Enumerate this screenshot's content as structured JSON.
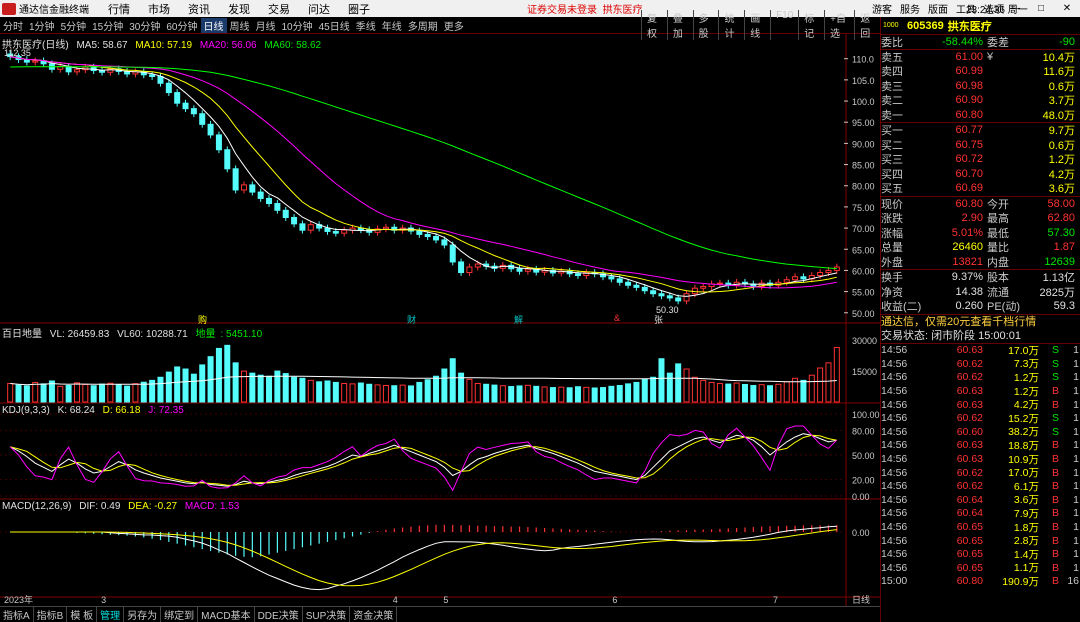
{
  "titlebar": {
    "app_name": "通达信金融终端",
    "menu": [
      "行情",
      "市场",
      "资讯",
      "发现",
      "交易",
      "问达",
      "圈子"
    ],
    "notice": "证券交易未登录",
    "stock": "拱东医疗",
    "right_menu": [
      "游客",
      "服务",
      "版面",
      "工具",
      "选项"
    ],
    "clock": "23:24:36 周一",
    "win": [
      "—",
      "□",
      "✕"
    ]
  },
  "periodbar": {
    "periods": [
      "分时",
      "1分钟",
      "5分钟",
      "15分钟",
      "30分钟",
      "60分钟",
      "日线",
      "周线",
      "月线",
      "10分钟",
      "45日线",
      "季线",
      "年线",
      "多周期",
      "更多"
    ],
    "active": "日线",
    "tools": [
      "复权",
      "叠加",
      "多股",
      "统计",
      "画线",
      "F10",
      "标记",
      "+自选",
      "返回"
    ]
  },
  "main_panel": {
    "title": "拱东医疗(日线)",
    "ma5": "MA5: 58.67",
    "ma10": "MA10: 57.19",
    "ma20": "MA20: 56.06",
    "ma60": "MA60: 58.62",
    "high_label": "112.35",
    "low_label": "50.30",
    "event_marks": [
      "购",
      "财",
      "解",
      "&",
      "张"
    ],
    "y_ticks": [
      "110.0",
      "105.0",
      "100.0",
      "95.00",
      "90.00",
      "85.00",
      "80.00",
      "75.00",
      "70.00",
      "65.00",
      "60.00",
      "55.00",
      "50.00"
    ]
  },
  "volume_panel": {
    "title": "百日地量",
    "vl": "VL: 26459.83",
    "vl60": "VL60: 10288.71",
    "label": "地量",
    "label_value": "5451.10",
    "y_ticks": [
      "30000",
      "15000"
    ]
  },
  "kdj_panel": {
    "title": "KDJ(9,3,3)",
    "k": "K: 68.24",
    "d": "D: 66.18",
    "j": "J: 72.35",
    "y_ticks": [
      "100.00",
      "80.00",
      "50.00",
      "20.00",
      "0.00"
    ]
  },
  "macd_panel": {
    "title": "MACD(12,26,9)",
    "dif": "DIF: 0.49",
    "dea": "DEA: -0.27",
    "macd": "MACD: 1.53",
    "y_ticks": [
      "0.00"
    ]
  },
  "x_axis": {
    "labels": [
      "2023年",
      "3",
      "4",
      "5",
      "6",
      "7"
    ],
    "period": "日线"
  },
  "right_panel": {
    "code": "605369",
    "name": "拱东医疗",
    "tag": "1000",
    "weibi_label": "委比",
    "weibi": "-58.44%",
    "weicha_label": "委差",
    "weicha": "-90",
    "asks": [
      {
        "label": "卖五",
        "mark": "¥",
        "price": "61.00",
        "vol": "10.4万"
      },
      {
        "label": "卖四",
        "mark": "",
        "price": "60.99",
        "vol": "11.6万"
      },
      {
        "label": "卖三",
        "mark": "",
        "price": "60.98",
        "vol": "0.6万"
      },
      {
        "label": "卖二",
        "mark": "",
        "price": "60.90",
        "vol": "3.7万"
      },
      {
        "label": "卖一",
        "mark": "",
        "price": "60.80",
        "vol": "48.0万"
      }
    ],
    "bids": [
      {
        "label": "买一",
        "price": "60.77",
        "vol": "9.7万"
      },
      {
        "label": "买二",
        "price": "60.75",
        "vol": "0.6万"
      },
      {
        "label": "买三",
        "price": "60.72",
        "vol": "1.2万"
      },
      {
        "label": "买四",
        "price": "60.70",
        "vol": "4.2万"
      },
      {
        "label": "买五",
        "price": "60.69",
        "vol": "3.6万"
      }
    ],
    "quote": [
      {
        "l1": "现价",
        "v1": "60.80",
        "c1": "red",
        "l2": "今开",
        "v2": "58.00",
        "c2": "red"
      },
      {
        "l1": "涨跌",
        "v1": "2.90",
        "c1": "red",
        "l2": "最高",
        "v2": "62.80",
        "c2": "red"
      },
      {
        "l1": "涨幅",
        "v1": "5.01%",
        "c1": "red",
        "l2": "最低",
        "v2": "57.30",
        "c2": "green"
      },
      {
        "l1": "总量",
        "v1": "26460",
        "c1": "yellow",
        "l2": "量比",
        "v2": "1.87",
        "c2": "red"
      },
      {
        "l1": "外盘",
        "v1": "13821",
        "c1": "red",
        "l2": "内盘",
        "v2": "12639",
        "c2": "green"
      }
    ],
    "stats": [
      {
        "l1": "换手",
        "v1": "9.37%",
        "l2": "股本",
        "v2": "1.13亿"
      },
      {
        "l1": "净资",
        "v1": "14.38",
        "l2": "流通",
        "v2": "2825万"
      },
      {
        "l1": "收益(二)",
        "v1": "0.260",
        "l2": "PE(动)",
        "v2": "59.3"
      }
    ],
    "ad": "通达信，仅需20元查看千档行情",
    "status_label": "交易状态:",
    "status_value": "闭市阶段 15:00:01",
    "trades": [
      {
        "t": "14:56",
        "p": "60.63",
        "q": "17.0万",
        "d": "S",
        "n": "1"
      },
      {
        "t": "14:56",
        "p": "60.62",
        "q": "7.3万",
        "d": "S",
        "n": "1"
      },
      {
        "t": "14:56",
        "p": "60.62",
        "q": "1.2万",
        "d": "S",
        "n": "1"
      },
      {
        "t": "14:56",
        "p": "60.63",
        "q": "1.2万",
        "d": "B",
        "n": "1"
      },
      {
        "t": "14:56",
        "p": "60.63",
        "q": "4.2万",
        "d": "B",
        "n": "1"
      },
      {
        "t": "14:56",
        "p": "60.62",
        "q": "15.2万",
        "d": "S",
        "n": "1"
      },
      {
        "t": "14:56",
        "p": "60.60",
        "q": "38.2万",
        "d": "S",
        "n": "1"
      },
      {
        "t": "14:56",
        "p": "60.63",
        "q": "18.8万",
        "d": "B",
        "n": "1"
      },
      {
        "t": "14:56",
        "p": "60.63",
        "q": "10.9万",
        "d": "B",
        "n": "1"
      },
      {
        "t": "14:56",
        "p": "60.62",
        "q": "17.0万",
        "d": "B",
        "n": "1"
      },
      {
        "t": "14:56",
        "p": "60.62",
        "q": "6.1万",
        "d": "B",
        "n": "1"
      },
      {
        "t": "14:56",
        "p": "60.64",
        "q": "3.6万",
        "d": "B",
        "n": "1"
      },
      {
        "t": "14:56",
        "p": "60.64",
        "q": "7.9万",
        "d": "B",
        "n": "1"
      },
      {
        "t": "14:56",
        "p": "60.65",
        "q": "1.8万",
        "d": "B",
        "n": "1"
      },
      {
        "t": "14:56",
        "p": "60.65",
        "q": "2.8万",
        "d": "B",
        "n": "1"
      },
      {
        "t": "14:56",
        "p": "60.65",
        "q": "1.4万",
        "d": "B",
        "n": "1"
      },
      {
        "t": "14:56",
        "p": "60.65",
        "q": "1.1万",
        "d": "B",
        "n": "1"
      },
      {
        "t": "15:00",
        "p": "60.80",
        "q": "190.9万",
        "d": "B",
        "n": "16"
      }
    ]
  },
  "bottombar": {
    "tabs": [
      "指标A",
      "指标B",
      "模 板",
      "管理",
      "另存为",
      "绑定到",
      "MACD基本",
      "DDE决策",
      "SUP决策",
      "资金决策"
    ],
    "active": "管理"
  },
  "colors": {
    "up": "#ff3232",
    "down": "#54fcfc",
    "ma5": "#ffffff",
    "ma10": "#ffff00",
    "ma20": "#ff00ff",
    "ma60": "#00ff00",
    "grid": "#800000"
  },
  "chart_data": {
    "type": "line",
    "title": "拱东医疗(日线)",
    "x_labels": [
      "2023年",
      "3",
      "4",
      "5",
      "6",
      "7"
    ],
    "y_range": [
      49,
      113
    ],
    "closes": [
      110.5,
      109.8,
      109.2,
      109.5,
      108.8,
      107.5,
      108.2,
      106.9,
      107.4,
      108.0,
      107.2,
      106.8,
      107.6,
      107.0,
      106.4,
      106.9,
      106.2,
      105.8,
      104.2,
      102.0,
      99.5,
      98.2,
      97.0,
      94.5,
      92.0,
      88.5,
      84.0,
      79.0,
      80.2,
      78.5,
      77.0,
      75.8,
      74.2,
      72.5,
      71.0,
      69.5,
      70.8,
      70.0,
      69.2,
      68.8,
      69.5,
      70.0,
      69.6,
      69.0,
      69.8,
      70.2,
      69.5,
      70.0,
      69.3,
      68.5,
      68.0,
      67.2,
      66.0,
      62.0,
      59.5,
      60.8,
      61.5,
      61.0,
      60.5,
      61.2,
      60.4,
      59.8,
      60.3,
      59.6,
      60.0,
      59.4,
      59.8,
      59.2,
      58.8,
      59.5,
      59.2,
      58.5,
      58.0,
      57.2,
      56.5,
      56.0,
      55.2,
      54.5,
      54.0,
      53.5,
      52.8,
      54.5,
      55.8,
      56.2,
      56.8,
      57.0,
      56.5,
      57.2,
      56.8,
      56.2,
      57.0,
      56.5,
      57.2,
      57.8,
      58.5,
      58.0,
      58.8,
      59.5,
      60.0,
      60.8
    ],
    "ma60_start": 108,
    "volumes": [
      9000,
      8200,
      7800,
      9500,
      8800,
      10200,
      7600,
      8000,
      9300,
      8500,
      7900,
      8700,
      9100,
      8300,
      7700,
      8900,
      9600,
      10500,
      12000,
      14500,
      17000,
      16000,
      13500,
      18000,
      22000,
      26000,
      27500,
      19000,
      15000,
      14000,
      13000,
      12500,
      15000,
      13800,
      12000,
      11500,
      10500,
      9800,
      10200,
      9500,
      9000,
      8800,
      9200,
      8600,
      8300,
      8000,
      7900,
      8200,
      7800,
      9500,
      10800,
      12500,
      16000,
      21000,
      14000,
      11000,
      9000,
      8600,
      8200,
      7900,
      7500,
      7800,
      8100,
      7600,
      7300,
      7000,
      7200,
      6900,
      7400,
      7100,
      6800,
      7000,
      7600,
      8000,
      8800,
      9500,
      11000,
      12000,
      21000,
      14000,
      18500,
      16000,
      12000,
      10500,
      9500,
      9000,
      8700,
      9200,
      8500,
      8000,
      8400,
      7900,
      8600,
      9800,
      11500,
      10500,
      13000,
      16500,
      19000,
      26460
    ],
    "kdj_k": [
      60,
      55,
      48,
      40,
      35,
      30,
      38,
      45,
      40,
      33,
      28,
      30,
      36,
      42,
      38,
      32,
      28,
      25,
      22,
      20,
      18,
      16,
      15,
      17,
      14,
      13,
      12,
      14,
      18,
      16,
      15,
      17,
      19,
      21,
      25,
      28,
      30,
      33,
      36,
      40,
      45,
      50,
      48,
      52,
      55,
      58,
      62,
      58,
      54,
      50,
      46,
      42,
      35,
      25,
      30,
      38,
      45,
      48,
      52,
      55,
      58,
      60,
      62,
      58,
      55,
      52,
      48,
      44,
      40,
      35,
      30,
      28,
      26,
      24,
      22,
      20,
      25,
      35,
      45,
      55,
      60,
      65,
      70,
      72,
      68,
      65,
      70,
      74,
      72,
      68,
      60,
      50,
      58,
      66,
      72,
      76,
      74,
      70,
      66,
      68
    ],
    "macd_bar": [
      -0.2,
      -0.3,
      -0.4,
      -0.5,
      -0.6,
      -0.7,
      -0.8,
      -1.0,
      -1.2,
      -1.5,
      -1.8,
      -2.2,
      -2.6,
      -3.0,
      -3.4,
      -3.8,
      -4.2,
      -4.6,
      -5.0,
      -5.3,
      -5.5,
      -5.6,
      -5.4,
      -5.0,
      -4.6,
      -4.2,
      -3.8,
      -3.4,
      -3.0,
      -2.6,
      -2.2,
      -1.8,
      -1.4,
      -1.0,
      -0.6,
      -0.2,
      0.2,
      0.5,
      0.8,
      1.0,
      1.2,
      1.4,
      1.5,
      1.6,
      1.6,
      1.6,
      1.5,
      1.5,
      1.4,
      1.4,
      1.3,
      1.3,
      1.2,
      1.2,
      1.1,
      1.0,
      0.9,
      0.8,
      0.7,
      0.6,
      0.5,
      0.4,
      0.3,
      0.2,
      0.1,
      0.05,
      0.0,
      0.0,
      0.05,
      0.1,
      0.2,
      0.3,
      0.35,
      0.4,
      0.5,
      0.55,
      0.6,
      0.7,
      0.8,
      0.9,
      1.0,
      1.1,
      1.2,
      1.3,
      1.3,
      1.4,
      1.4,
      1.5,
      1.5,
      1.5,
      1.5,
      1.53
    ]
  }
}
